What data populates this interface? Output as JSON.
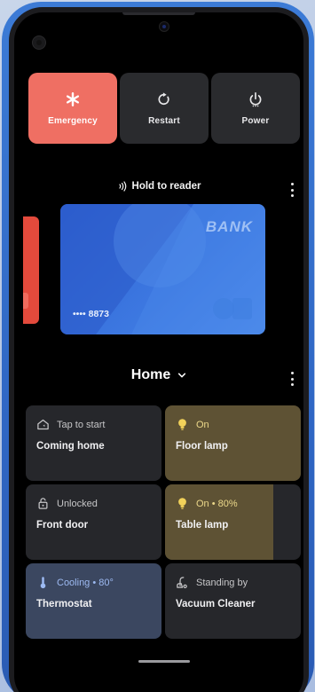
{
  "power_menu": {
    "emergency": {
      "label": "Emergency",
      "icon": "asterisk-icon"
    },
    "restart": {
      "label": "Restart",
      "icon": "restart-icon"
    },
    "power": {
      "label": "Power",
      "icon": "power-icon"
    }
  },
  "wallet": {
    "hold_label": "Hold to reader",
    "card": {
      "bank": "BANK",
      "number": "•••• 8873"
    }
  },
  "home": {
    "title": "Home",
    "tiles": [
      {
        "status": "Tap to start",
        "name": "Coming home",
        "icon": "home-routine-icon"
      },
      {
        "status": "On",
        "name": "Floor lamp",
        "icon": "lightbulb-icon"
      },
      {
        "status": "Unlocked",
        "name": "Front door",
        "icon": "unlocked-icon"
      },
      {
        "status": "On • 80%",
        "name": "Table lamp",
        "icon": "lightbulb-icon",
        "level": 0.8
      },
      {
        "status": "Cooling • 80°",
        "name": "Thermostat",
        "icon": "thermometer-icon"
      },
      {
        "status": "Standing by",
        "name": "Vacuum Cleaner",
        "icon": "vacuum-icon"
      }
    ]
  },
  "colors": {
    "emergency": "#ef6f63",
    "lamp_on": "#5e5234",
    "lamp_icon": "#f2d25a",
    "cooling": "#3b4760",
    "card": "#3c77e0"
  }
}
